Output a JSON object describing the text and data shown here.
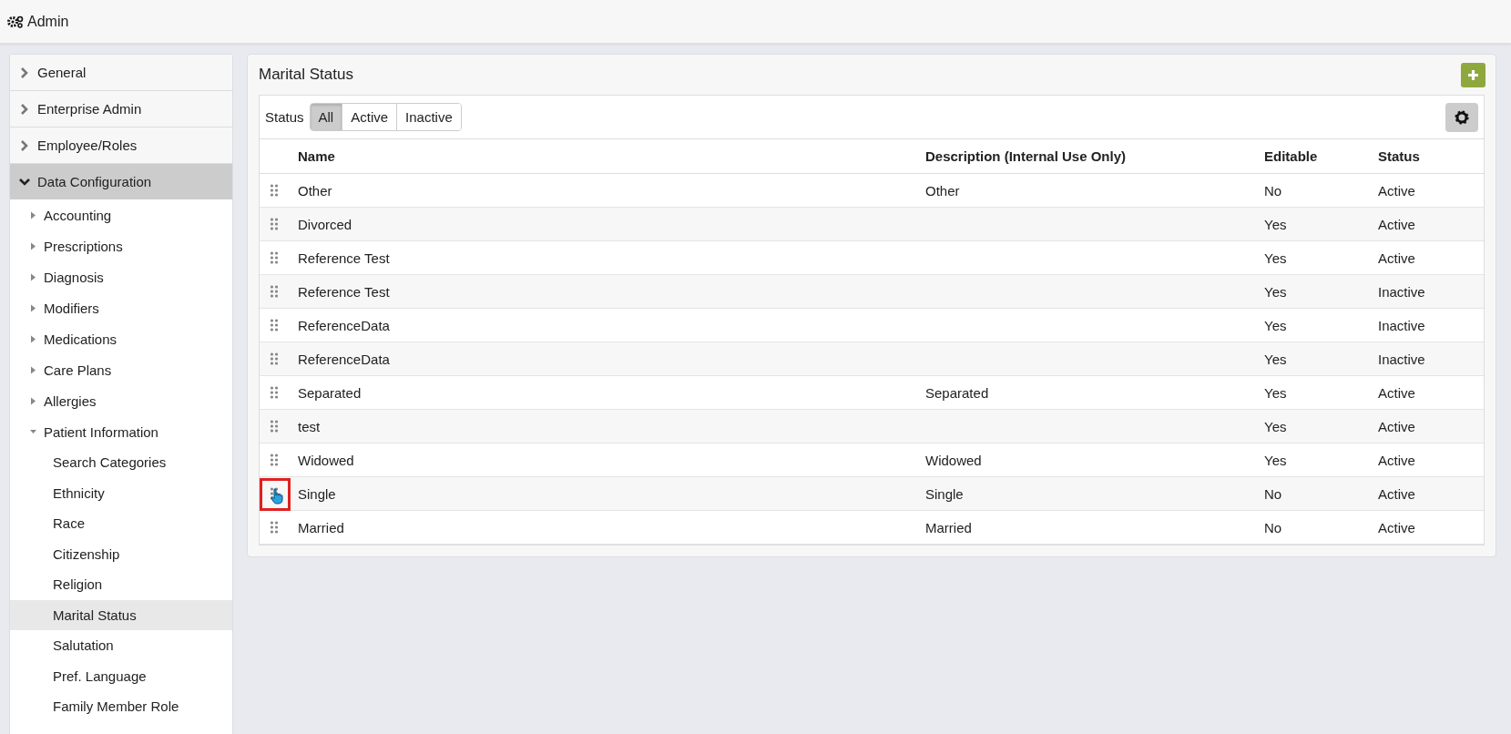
{
  "header": {
    "title": "Admin"
  },
  "sidebar": {
    "items": [
      {
        "label": "General",
        "expanded": false
      },
      {
        "label": "Enterprise Admin",
        "expanded": false
      },
      {
        "label": "Employee/Roles",
        "expanded": false
      },
      {
        "label": "Data Configuration",
        "expanded": true,
        "children": [
          {
            "label": "Accounting",
            "expanded": false
          },
          {
            "label": "Prescriptions",
            "expanded": false
          },
          {
            "label": "Diagnosis",
            "expanded": false
          },
          {
            "label": "Modifiers",
            "expanded": false
          },
          {
            "label": "Medications",
            "expanded": false
          },
          {
            "label": "Care Plans",
            "expanded": false
          },
          {
            "label": "Allergies",
            "expanded": false
          },
          {
            "label": "Patient Information",
            "expanded": true,
            "children": [
              {
                "label": "Search Categories",
                "selected": false
              },
              {
                "label": "Ethnicity",
                "selected": false
              },
              {
                "label": "Race",
                "selected": false
              },
              {
                "label": "Citizenship",
                "selected": false
              },
              {
                "label": "Religion",
                "selected": false
              },
              {
                "label": "Marital Status",
                "selected": true
              },
              {
                "label": "Salutation",
                "selected": false
              },
              {
                "label": "Pref. Language",
                "selected": false
              },
              {
                "label": "Family Member Role",
                "selected": false
              }
            ]
          }
        ]
      }
    ]
  },
  "panel": {
    "title": "Marital Status",
    "filter": {
      "label": "Status",
      "options": [
        {
          "label": "All",
          "selected": true
        },
        {
          "label": "Active",
          "selected": false
        },
        {
          "label": "Inactive",
          "selected": false
        }
      ]
    },
    "table": {
      "columns": [
        "Name",
        "Description (Internal Use Only)",
        "Editable",
        "Status"
      ],
      "rows": [
        {
          "cells": [
            "Other",
            "Other",
            "No",
            "Active"
          ],
          "highlighted": false
        },
        {
          "cells": [
            "Divorced",
            "",
            "Yes",
            "Active"
          ],
          "highlighted": false
        },
        {
          "cells": [
            "Reference Test",
            "",
            "Yes",
            "Active"
          ],
          "highlighted": false
        },
        {
          "cells": [
            "Reference Test",
            "",
            "Yes",
            "Inactive"
          ],
          "highlighted": false
        },
        {
          "cells": [
            "ReferenceData",
            "",
            "Yes",
            "Inactive"
          ],
          "highlighted": false
        },
        {
          "cells": [
            "ReferenceData",
            "",
            "Yes",
            "Inactive"
          ],
          "highlighted": false
        },
        {
          "cells": [
            "Separated",
            "Separated",
            "Yes",
            "Active"
          ],
          "highlighted": false
        },
        {
          "cells": [
            "test",
            "",
            "Yes",
            "Active"
          ],
          "highlighted": false
        },
        {
          "cells": [
            "Widowed",
            "Widowed",
            "Yes",
            "Active"
          ],
          "highlighted": false
        },
        {
          "cells": [
            "Single",
            "Single",
            "No",
            "Active"
          ],
          "highlighted": true
        },
        {
          "cells": [
            "Married",
            "Married",
            "No",
            "Active"
          ],
          "highlighted": false
        }
      ]
    }
  }
}
